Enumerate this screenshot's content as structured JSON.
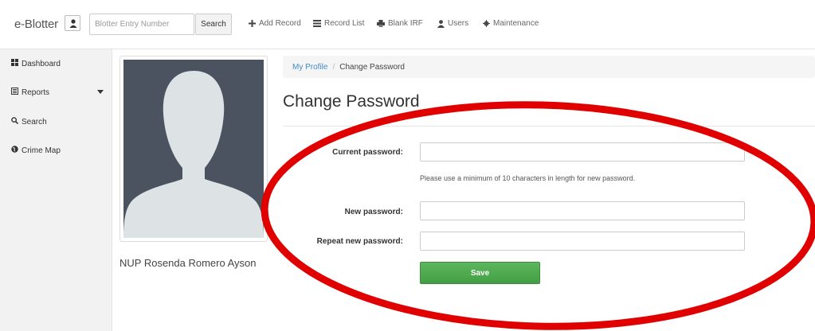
{
  "app": {
    "brand": "e-Blotter"
  },
  "search": {
    "placeholder": "Blotter Entry Number",
    "button_label": "Search"
  },
  "nav": {
    "items": [
      {
        "label": "Add Record",
        "icon": "plus-icon"
      },
      {
        "label": "Record List",
        "icon": "list-icon"
      },
      {
        "label": "Blank IRF",
        "icon": "print-icon"
      },
      {
        "label": "Users",
        "icon": "user-icon"
      },
      {
        "label": "Maintenance",
        "icon": "cog-icon"
      }
    ]
  },
  "sidebar": {
    "items": [
      {
        "label": "Dashboard",
        "icon": "dashboard-icon"
      },
      {
        "label": "Reports",
        "icon": "reports-icon",
        "has_dropdown": true
      },
      {
        "label": "Search",
        "icon": "search-icon"
      },
      {
        "label": "Crime Map",
        "icon": "globe-icon"
      }
    ]
  },
  "profile": {
    "name": "NUP Rosenda Romero Ayson"
  },
  "breadcrumb": {
    "link": "My Profile",
    "separator": "/",
    "current": "Change Password"
  },
  "page": {
    "title": "Change Password"
  },
  "form": {
    "current_password_label": "Current password:",
    "current_password_value": "",
    "help_text": "Please use a minimum of 10 characters in length for new password.",
    "new_password_label": "New password:",
    "new_password_value": "",
    "repeat_password_label": "Repeat new password:",
    "repeat_password_value": "",
    "save_label": "Save"
  },
  "colors": {
    "link": "#428bca",
    "save_button": "#5cb85c",
    "annotation": "#e00000",
    "sidebar_bg": "#f2f2f2"
  }
}
